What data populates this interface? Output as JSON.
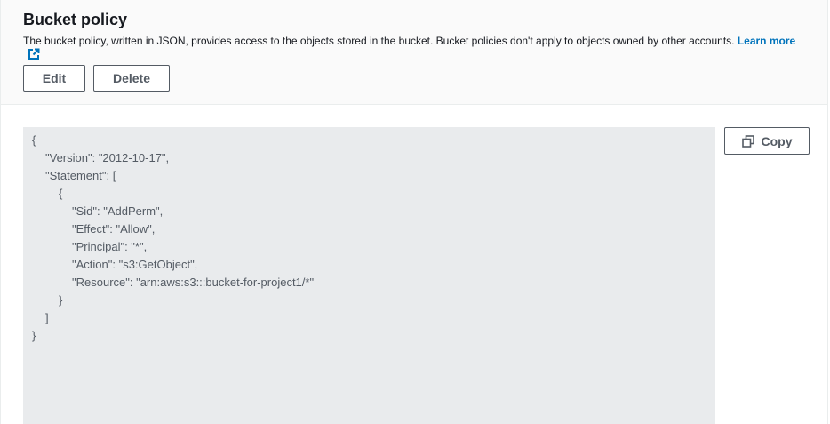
{
  "header": {
    "title": "Bucket policy",
    "description": "The bucket policy, written in JSON, provides access to the objects stored in the bucket. Bucket policies don't apply to objects owned by other accounts. ",
    "learn_more": "Learn more",
    "external_link_icon": "external-link-icon"
  },
  "actions": {
    "edit_label": "Edit",
    "delete_label": "Delete"
  },
  "policy": {
    "lines": [
      {
        "indent": 0,
        "text": "{"
      },
      {
        "indent": 1,
        "text": "\"Version\": \"2012-10-17\","
      },
      {
        "indent": 1,
        "text": "\"Statement\": ["
      },
      {
        "indent": 2,
        "text": "{"
      },
      {
        "indent": 3,
        "text": "\"Sid\": \"AddPerm\","
      },
      {
        "indent": 3,
        "text": "\"Effect\": \"Allow\","
      },
      {
        "indent": 3,
        "text": "\"Principal\": \"*\","
      },
      {
        "indent": 3,
        "text": "\"Action\": \"s3:GetObject\","
      },
      {
        "indent": 3,
        "text": "\"Resource\": \"arn:aws:s3:::bucket-for-project1/*\""
      },
      {
        "indent": 2,
        "text": "}"
      },
      {
        "indent": 1,
        "text": "]"
      },
      {
        "indent": 0,
        "text": "}"
      }
    ]
  },
  "copy": {
    "label": "Copy",
    "icon": "copy-icon"
  },
  "colors": {
    "link": "#0073bb",
    "code_background": "#e9ebed",
    "button_border": "#545b64"
  }
}
